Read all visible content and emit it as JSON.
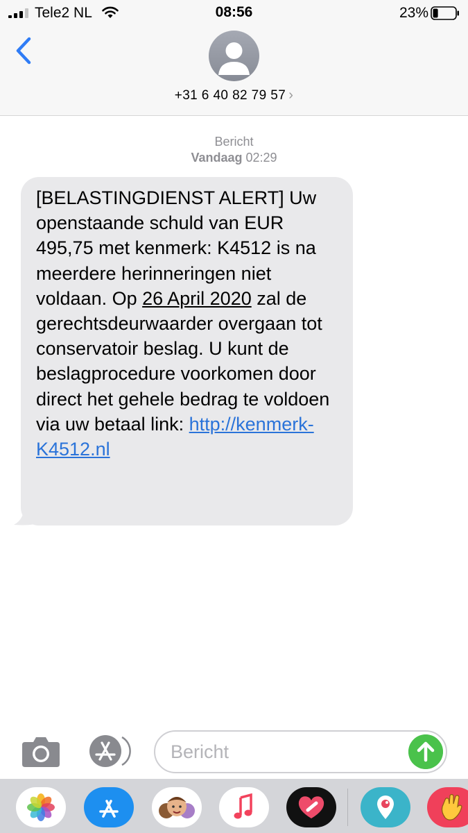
{
  "status_bar": {
    "carrier": "Tele2 NL",
    "time": "08:56",
    "battery_percent": "23%",
    "battery_level": 0.23
  },
  "nav": {
    "back_icon": "chevron-left-icon",
    "contact_number": "+31 6 40 82 79 57",
    "contact_chevron": "›"
  },
  "conversation": {
    "service_label": "Bericht",
    "day_label": "Vandaag",
    "time_label": "02:29",
    "message": {
      "part1": "[BELASTINGDIENST ALERT] Uw openstaande schuld van EUR 495,75 met kenmerk: K4512 is na meerdere herinneringen niet voldaan. Op ",
      "date_link": "26 April 2020",
      "part2": " zal de gerechtsdeurwaarder overgaan tot conservatoir beslag. U kunt de beslagprocedure voorkomen door direct het gehele bedrag te voldoen via uw betaal link: ",
      "url": "http://kenmerk-K4512.nl"
    }
  },
  "input_bar": {
    "placeholder": "Bericht"
  },
  "colors": {
    "accent_blue": "#2f7cf6",
    "link_blue": "#2a73d9",
    "send_green": "#4ac24b",
    "bubble_gray": "#e9e9eb"
  },
  "app_drawer": [
    "photos-icon",
    "app-store-icon",
    "memoji-icon",
    "music-icon",
    "heart-app-icon",
    "periscope-icon",
    "wave-hand-icon"
  ]
}
